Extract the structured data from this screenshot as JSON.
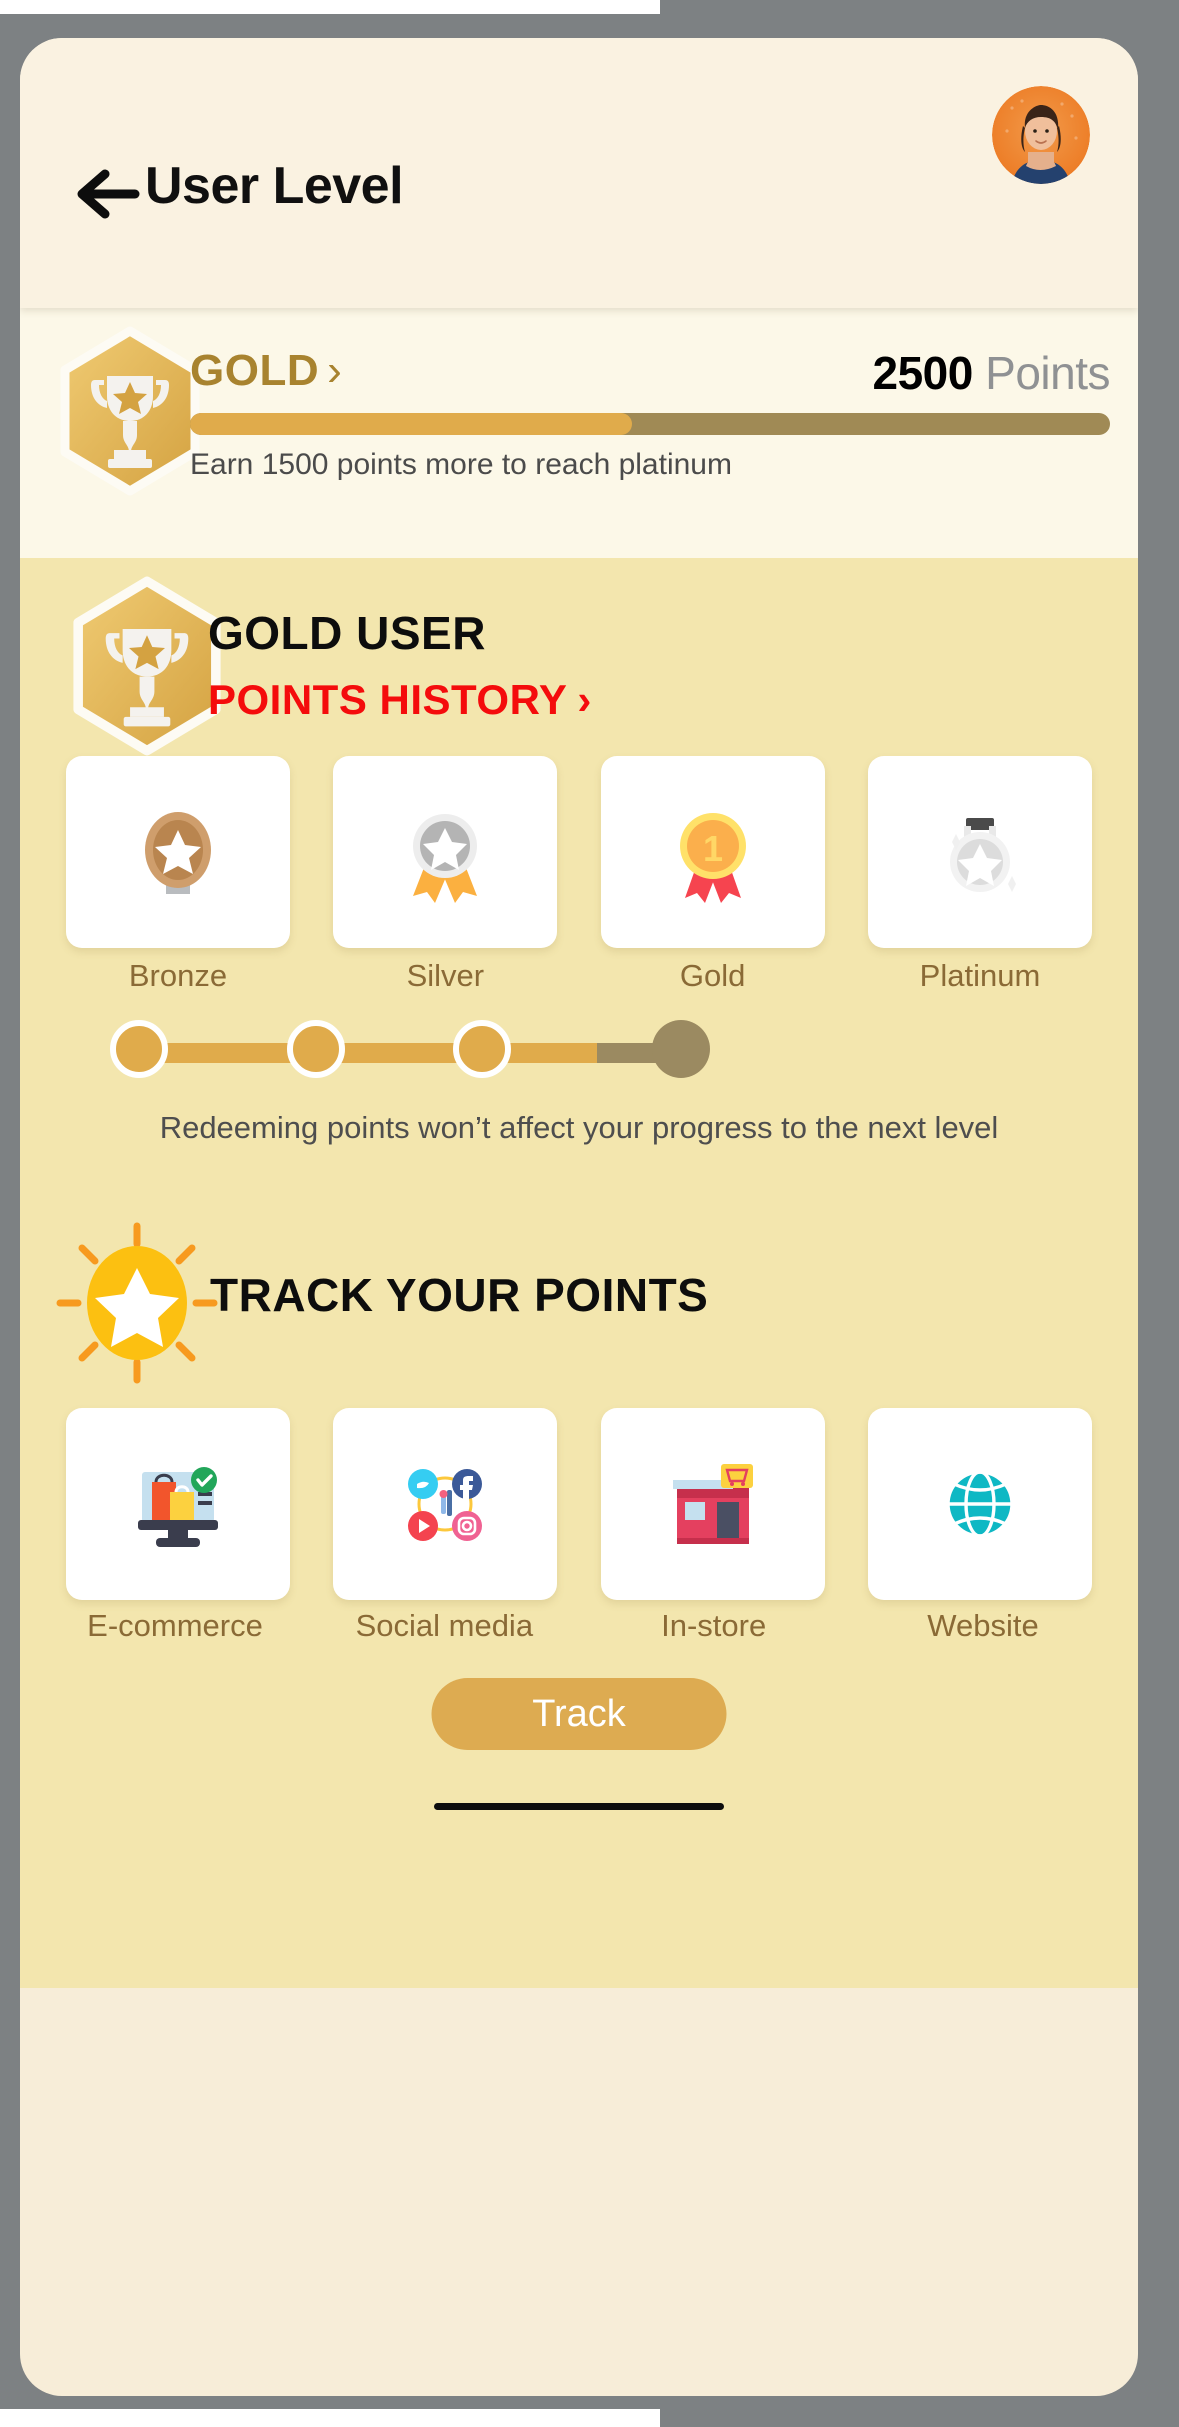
{
  "header": {
    "title": "User Level",
    "back_icon": "arrow-left-icon",
    "avatar_alt": "user-avatar"
  },
  "summary": {
    "tier": "GOLD",
    "chevron": "›",
    "points_value": "2500",
    "points_label": "Points",
    "progress_percent": 48,
    "progress_fill_color": "#e0ab4b",
    "progress_track_color": "#a08a55",
    "hint": "Earn 1500 points more to reach platinum"
  },
  "level_section": {
    "title": "GOLD USER",
    "history_link": "POINTS HISTORY",
    "history_chevron": "›",
    "history_color": "#f40c0c",
    "tiers": [
      {
        "label": "Bronze",
        "icon": "bronze-medal-icon"
      },
      {
        "label": "Silver",
        "icon": "silver-medal-icon"
      },
      {
        "label": "Gold",
        "icon": "gold-medal-icon"
      },
      {
        "label": "Platinum",
        "icon": "platinum-medal-icon"
      }
    ],
    "steps": {
      "total": 4,
      "completed": 3,
      "active_color": "#e0ab4b",
      "inactive_color": "#9b8a61"
    },
    "note": "Redeeming points won’t affect your progress to the next level"
  },
  "track_section": {
    "title": "TRACK YOUR POINTS",
    "icon": "sun-star-icon",
    "channels": [
      {
        "label": "E-commerce",
        "icon": "ecommerce-icon"
      },
      {
        "label": "Social media",
        "icon": "social-media-icon"
      },
      {
        "label": "In-store",
        "icon": "store-icon"
      },
      {
        "label": "Website",
        "icon": "globe-icon"
      }
    ],
    "button_label": "Track"
  }
}
